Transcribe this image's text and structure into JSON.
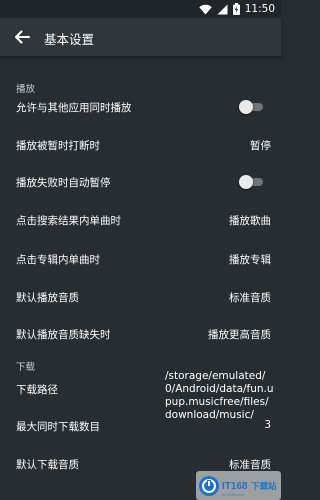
{
  "status": {
    "time": "11:50"
  },
  "appbar": {
    "title": "基本设置"
  },
  "sections": {
    "playback": "播放",
    "download": "下载"
  },
  "playback_rows": [
    {
      "label": "允许与其他应用同时播放",
      "toggle": false
    },
    {
      "label": "播放被暂时打断时",
      "value": "暂停"
    },
    {
      "label": "播放失败时自动暂停",
      "toggle": false
    },
    {
      "label": "点击搜索结果内单曲时",
      "value": "播放歌曲"
    },
    {
      "label": "点击专辑内单曲时",
      "value": "播放专辑"
    },
    {
      "label": "默认播放音质",
      "value": "标准音质"
    },
    {
      "label": "默认播放音质缺失时",
      "value": "播放更高音质"
    }
  ],
  "download_rows": [
    {
      "label": "下载路径",
      "value": "/storage/emulated/0/Android/data/fun.upup.musicfree/files/download/music/"
    },
    {
      "label": "最大同时下载数目",
      "value": "3"
    },
    {
      "label": "默认下载音质",
      "value": "标准音质"
    }
  ],
  "watermark": {
    "text": "IT168下载站"
  },
  "colors": {
    "background": "#262d33",
    "appbar": "#2f363c",
    "toggle_off_track": "#6f7479",
    "toggle_thumb": "#e8eaec"
  }
}
